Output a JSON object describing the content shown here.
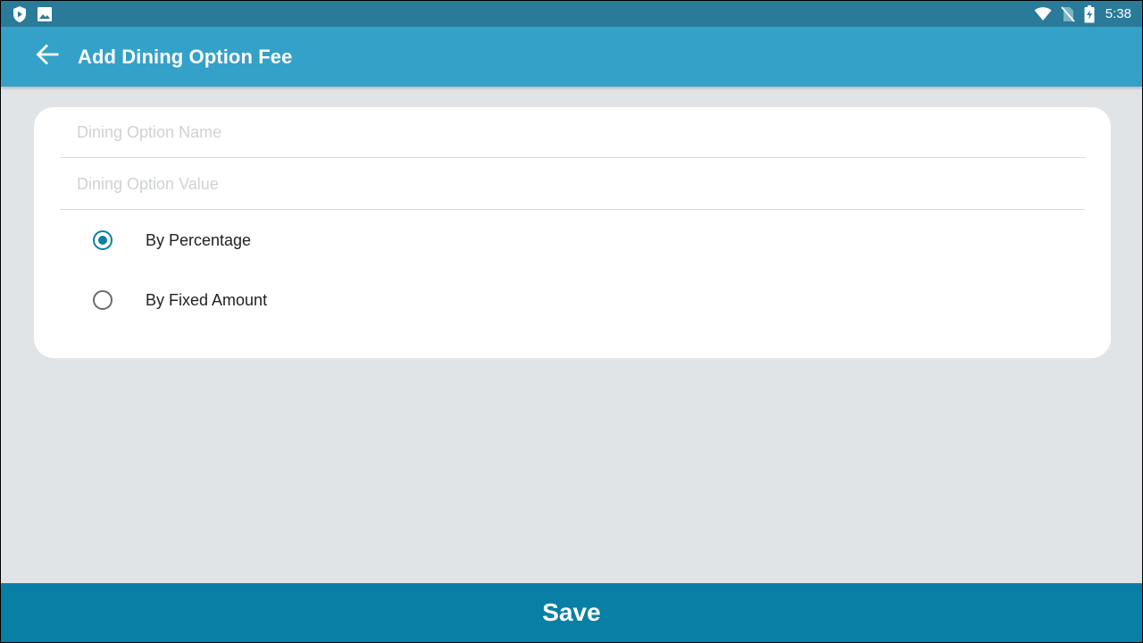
{
  "status_bar": {
    "left_icons": [
      "shield-play-icon",
      "image-icon"
    ],
    "right_icons": [
      "wifi-icon",
      "no-sim-icon",
      "battery-charging-icon"
    ],
    "time": "5:38"
  },
  "app_bar": {
    "back_icon": "arrow-left-icon",
    "title": "Add Dining Option Fee"
  },
  "form": {
    "name_field": {
      "value": "",
      "placeholder": "Dining Option Name"
    },
    "value_field": {
      "value": "",
      "placeholder": "Dining Option Value"
    },
    "fee_type": {
      "options": [
        {
          "label": "By Percentage",
          "selected": true
        },
        {
          "label": "By Fixed Amount",
          "selected": false
        }
      ]
    }
  },
  "footer": {
    "save_label": "Save"
  },
  "colors": {
    "status_bar": "#2a7a9a",
    "app_bar": "#34a1c9",
    "accent": "#0a7fa6",
    "background": "#e0e4e6",
    "card": "#ffffff"
  }
}
